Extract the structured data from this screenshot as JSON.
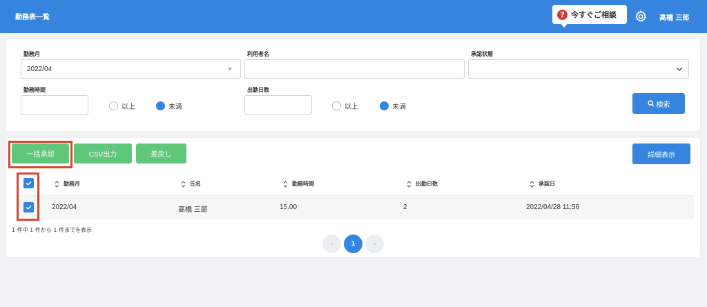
{
  "header": {
    "title": "勤務表一覧",
    "help_label": "今すぐご相談",
    "help_icon": "?",
    "user_name": "高橋 三郎"
  },
  "search": {
    "work_month": {
      "label": "勤務月",
      "value": "2022/04",
      "clear": "×"
    },
    "user_name": {
      "label": "利用者名",
      "value": ""
    },
    "approval_status": {
      "label": "承認状態",
      "value": ""
    },
    "work_hours": {
      "label": "勤務時間",
      "value": "",
      "option_above": "以上",
      "option_below": "未満",
      "selected": "未満"
    },
    "work_days": {
      "label": "出勤日数",
      "value": "",
      "option_above": "以上",
      "option_below": "未満",
      "selected": "未満"
    },
    "search_button": "検索"
  },
  "toolbar": {
    "bulk_approve": "一括承認",
    "csv_export": "CSV出力",
    "send_back": "差戻し",
    "show_detail": "詳細表示"
  },
  "table": {
    "columns": [
      "勤務月",
      "氏名",
      "勤務時間",
      "出勤日数",
      "承認日"
    ],
    "rows": [
      {
        "month": "2022/04",
        "name": "高橋 三郎",
        "hours": "15.00",
        "days": "2",
        "approved_at": "2022/04/28 11:56",
        "checked": true
      }
    ],
    "header_checked": true
  },
  "pagination": {
    "info": "1 件中 1 件から 1 件までを表示",
    "prev": "‹",
    "current": "1",
    "next": "›"
  },
  "colors": {
    "primary": "#3585de",
    "green": "#5fc67a",
    "highlight": "#e0432f",
    "help_icon": "#d33b3b"
  }
}
